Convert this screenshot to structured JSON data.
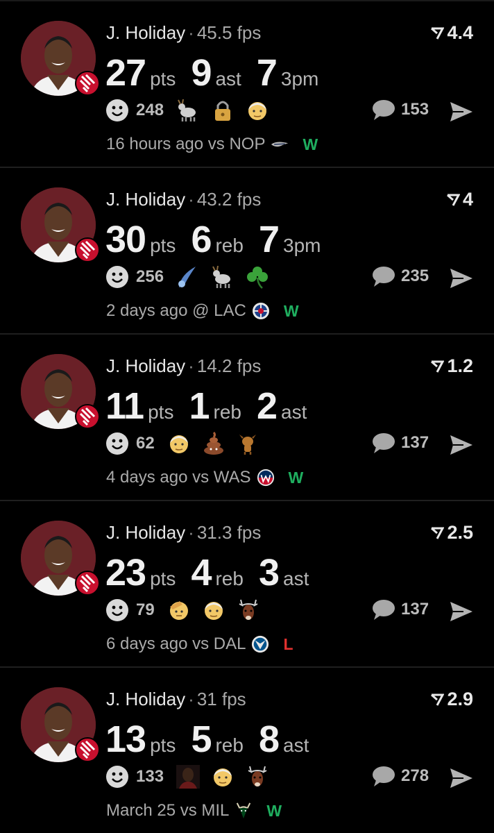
{
  "colors": {
    "win": "#1fae5f",
    "loss": "#e0312f",
    "avatar_bg": "#6a2027"
  },
  "posts": [
    {
      "player": "J. Holiday",
      "fps": "45.5 fps",
      "score": "4.4",
      "stats": [
        {
          "value": "27",
          "label": "pts"
        },
        {
          "value": "9",
          "label": "ast"
        },
        {
          "value": "7",
          "label": "3pm"
        }
      ],
      "reaction_count": "248",
      "reactions": [
        "goat-icon",
        "lock-icon",
        "old-man-icon"
      ],
      "comments": "153",
      "time": "16 hours ago",
      "venue": "vs",
      "opponent": "NOP",
      "opponent_logo": "pelicans-logo-icon",
      "result": "W"
    },
    {
      "player": "J. Holiday",
      "fps": "43.2 fps",
      "score": "4",
      "stats": [
        {
          "value": "30",
          "label": "pts"
        },
        {
          "value": "6",
          "label": "reb"
        },
        {
          "value": "7",
          "label": "3pm"
        }
      ],
      "reaction_count": "256",
      "reactions": [
        "comet-icon",
        "goat-icon",
        "shamrock-icon"
      ],
      "comments": "235",
      "time": "2 days ago",
      "venue": "@",
      "opponent": "LAC",
      "opponent_logo": "clippers-logo-icon",
      "result": "W"
    },
    {
      "player": "J. Holiday",
      "fps": "14.2 fps",
      "score": "1.2",
      "stats": [
        {
          "value": "11",
          "label": "pts"
        },
        {
          "value": "1",
          "label": "reb"
        },
        {
          "value": "2",
          "label": "ast"
        }
      ],
      "reaction_count": "62",
      "reactions": [
        "old-man-icon",
        "poop-icon",
        "dog-icon"
      ],
      "comments": "137",
      "time": "4 days ago",
      "venue": "vs",
      "opponent": "WAS",
      "opponent_logo": "wizards-logo-icon",
      "result": "W"
    },
    {
      "player": "J. Holiday",
      "fps": "31.3 fps",
      "score": "2.5",
      "stats": [
        {
          "value": "23",
          "label": "pts"
        },
        {
          "value": "4",
          "label": "reb"
        },
        {
          "value": "3",
          "label": "ast"
        }
      ],
      "reaction_count": "79",
      "reactions": [
        "saluting-face-icon",
        "old-man-icon",
        "deer-icon"
      ],
      "comments": "137",
      "time": "6 days ago",
      "venue": "vs",
      "opponent": "DAL",
      "opponent_logo": "mavericks-logo-icon",
      "result": "L"
    },
    {
      "player": "J. Holiday",
      "fps": "31 fps",
      "score": "2.9",
      "stats": [
        {
          "value": "13",
          "label": "pts"
        },
        {
          "value": "5",
          "label": "reb"
        },
        {
          "value": "8",
          "label": "ast"
        }
      ],
      "reaction_count": "133",
      "reactions": [
        "player-photo-icon",
        "old-man-icon",
        "deer-icon"
      ],
      "comments": "278",
      "time": "March 25",
      "venue": "vs",
      "opponent": "MIL",
      "opponent_logo": "bucks-logo-icon",
      "result": "W"
    }
  ]
}
